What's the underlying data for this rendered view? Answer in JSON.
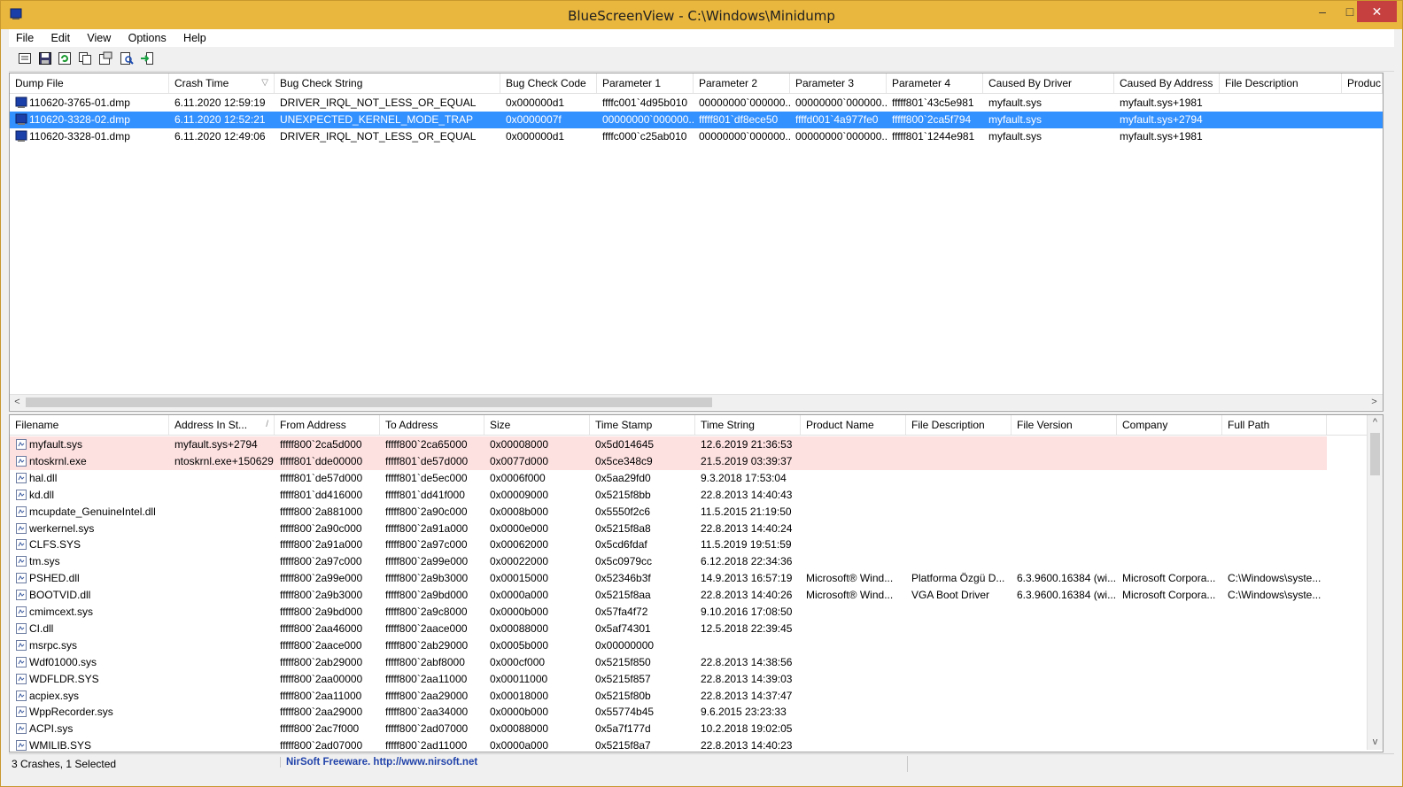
{
  "window": {
    "title": "BlueScreenView  -  C:\\Windows\\Minidump",
    "min": "–",
    "max": "□",
    "close": "✕"
  },
  "menu": [
    "File",
    "Edit",
    "View",
    "Options",
    "Help"
  ],
  "toolbar": [
    "properties-icon",
    "save-icon",
    "refresh-icon",
    "copy-icon",
    "html-report-icon",
    "find-icon",
    "exit-icon"
  ],
  "crashes": {
    "columns": [
      "Dump File",
      "Crash Time",
      "Bug Check String",
      "Bug Check Code",
      "Parameter 1",
      "Parameter 2",
      "Parameter 3",
      "Parameter 4",
      "Caused By Driver",
      "Caused By Address",
      "File Description",
      "Produc"
    ],
    "rows": [
      [
        "110620-3765-01.dmp",
        "6.11.2020 12:59:19",
        "DRIVER_IRQL_NOT_LESS_OR_EQUAL",
        "0x000000d1",
        "ffffc001`4d95b010",
        "00000000`000000...",
        "00000000`000000...",
        "fffff801`43c5e981",
        "myfault.sys",
        "myfault.sys+1981",
        "",
        ""
      ],
      [
        "110620-3328-02.dmp",
        "6.11.2020 12:52:21",
        "UNEXPECTED_KERNEL_MODE_TRAP",
        "0x0000007f",
        "00000000`000000...",
        "fffff801`df8ece50",
        "ffffd001`4a977fe0",
        "fffff800`2ca5f794",
        "myfault.sys",
        "myfault.sys+2794",
        "",
        ""
      ],
      [
        "110620-3328-01.dmp",
        "6.11.2020 12:49:06",
        "DRIVER_IRQL_NOT_LESS_OR_EQUAL",
        "0x000000d1",
        "ffffc000`c25ab010",
        "00000000`000000...",
        "00000000`000000...",
        "fffff801`1244e981",
        "myfault.sys",
        "myfault.sys+1981",
        "",
        ""
      ]
    ]
  },
  "drivers": {
    "columns": [
      "Filename",
      "Address In St...",
      "From Address",
      "To Address",
      "Size",
      "Time Stamp",
      "Time String",
      "Product Name",
      "File Description",
      "File Version",
      "Company",
      "Full Path"
    ],
    "rows": [
      [
        "myfault.sys",
        "myfault.sys+2794",
        "fffff800`2ca5d000",
        "fffff800`2ca65000",
        "0x00008000",
        "0x5d014645",
        "12.6.2019 21:36:53",
        "",
        "",
        "",
        "",
        ""
      ],
      [
        "ntoskrnl.exe",
        "ntoskrnl.exe+150629",
        "fffff801`dde00000",
        "fffff801`de57d000",
        "0x0077d000",
        "0x5ce348c9",
        "21.5.2019 03:39:37",
        "",
        "",
        "",
        "",
        ""
      ],
      [
        "hal.dll",
        "",
        "fffff801`de57d000",
        "fffff801`de5ec000",
        "0x0006f000",
        "0x5aa29fd0",
        "9.3.2018 17:53:04",
        "",
        "",
        "",
        "",
        ""
      ],
      [
        "kd.dll",
        "",
        "fffff801`dd416000",
        "fffff801`dd41f000",
        "0x00009000",
        "0x5215f8bb",
        "22.8.2013 14:40:43",
        "",
        "",
        "",
        "",
        ""
      ],
      [
        "mcupdate_GenuineIntel.dll",
        "",
        "fffff800`2a881000",
        "fffff800`2a90c000",
        "0x0008b000",
        "0x5550f2c6",
        "11.5.2015 21:19:50",
        "",
        "",
        "",
        "",
        ""
      ],
      [
        "werkernel.sys",
        "",
        "fffff800`2a90c000",
        "fffff800`2a91a000",
        "0x0000e000",
        "0x5215f8a8",
        "22.8.2013 14:40:24",
        "",
        "",
        "",
        "",
        ""
      ],
      [
        "CLFS.SYS",
        "",
        "fffff800`2a91a000",
        "fffff800`2a97c000",
        "0x00062000",
        "0x5cd6fdaf",
        "11.5.2019 19:51:59",
        "",
        "",
        "",
        "",
        ""
      ],
      [
        "tm.sys",
        "",
        "fffff800`2a97c000",
        "fffff800`2a99e000",
        "0x00022000",
        "0x5c0979cc",
        "6.12.2018 22:34:36",
        "",
        "",
        "",
        "",
        ""
      ],
      [
        "PSHED.dll",
        "",
        "fffff800`2a99e000",
        "fffff800`2a9b3000",
        "0x00015000",
        "0x52346b3f",
        "14.9.2013 16:57:19",
        "Microsoft® Wind...",
        "Platforma Özgü D...",
        "6.3.9600.16384 (wi...",
        "Microsoft Corpora...",
        "C:\\Windows\\syste..."
      ],
      [
        "BOOTVID.dll",
        "",
        "fffff800`2a9b3000",
        "fffff800`2a9bd000",
        "0x0000a000",
        "0x5215f8aa",
        "22.8.2013 14:40:26",
        "Microsoft® Wind...",
        "VGA Boot Driver",
        "6.3.9600.16384 (wi...",
        "Microsoft Corpora...",
        "C:\\Windows\\syste..."
      ],
      [
        "cmimcext.sys",
        "",
        "fffff800`2a9bd000",
        "fffff800`2a9c8000",
        "0x0000b000",
        "0x57fa4f72",
        "9.10.2016 17:08:50",
        "",
        "",
        "",
        "",
        ""
      ],
      [
        "CI.dll",
        "",
        "fffff800`2aa46000",
        "fffff800`2aace000",
        "0x00088000",
        "0x5af74301",
        "12.5.2018 22:39:45",
        "",
        "",
        "",
        "",
        ""
      ],
      [
        "msrpc.sys",
        "",
        "fffff800`2aace000",
        "fffff800`2ab29000",
        "0x0005b000",
        "0x00000000",
        "",
        "",
        "",
        "",
        "",
        ""
      ],
      [
        "Wdf01000.sys",
        "",
        "fffff800`2ab29000",
        "fffff800`2abf8000",
        "0x000cf000",
        "0x5215f850",
        "22.8.2013 14:38:56",
        "",
        "",
        "",
        "",
        ""
      ],
      [
        "WDFLDR.SYS",
        "",
        "fffff800`2aa00000",
        "fffff800`2aa11000",
        "0x00011000",
        "0x5215f857",
        "22.8.2013 14:39:03",
        "",
        "",
        "",
        "",
        ""
      ],
      [
        "acpiex.sys",
        "",
        "fffff800`2aa11000",
        "fffff800`2aa29000",
        "0x00018000",
        "0x5215f80b",
        "22.8.2013 14:37:47",
        "",
        "",
        "",
        "",
        ""
      ],
      [
        "WppRecorder.sys",
        "",
        "fffff800`2aa29000",
        "fffff800`2aa34000",
        "0x0000b000",
        "0x55774b45",
        "9.6.2015 23:23:33",
        "",
        "",
        "",
        "",
        ""
      ],
      [
        "ACPI.sys",
        "",
        "fffff800`2ac7f000",
        "fffff800`2ad07000",
        "0x00088000",
        "0x5a7f177d",
        "10.2.2018 19:02:05",
        "",
        "",
        "",
        "",
        ""
      ],
      [
        "WMILIB.SYS",
        "",
        "fffff800`2ad07000",
        "fffff800`2ad11000",
        "0x0000a000",
        "0x5215f8a7",
        "22.8.2013 14:40:23",
        "",
        "",
        "",
        "",
        ""
      ]
    ]
  },
  "status": {
    "left": "3 Crashes, 1 Selected",
    "mid": "NirSoft Freeware.  http://www.nirsoft.net"
  }
}
